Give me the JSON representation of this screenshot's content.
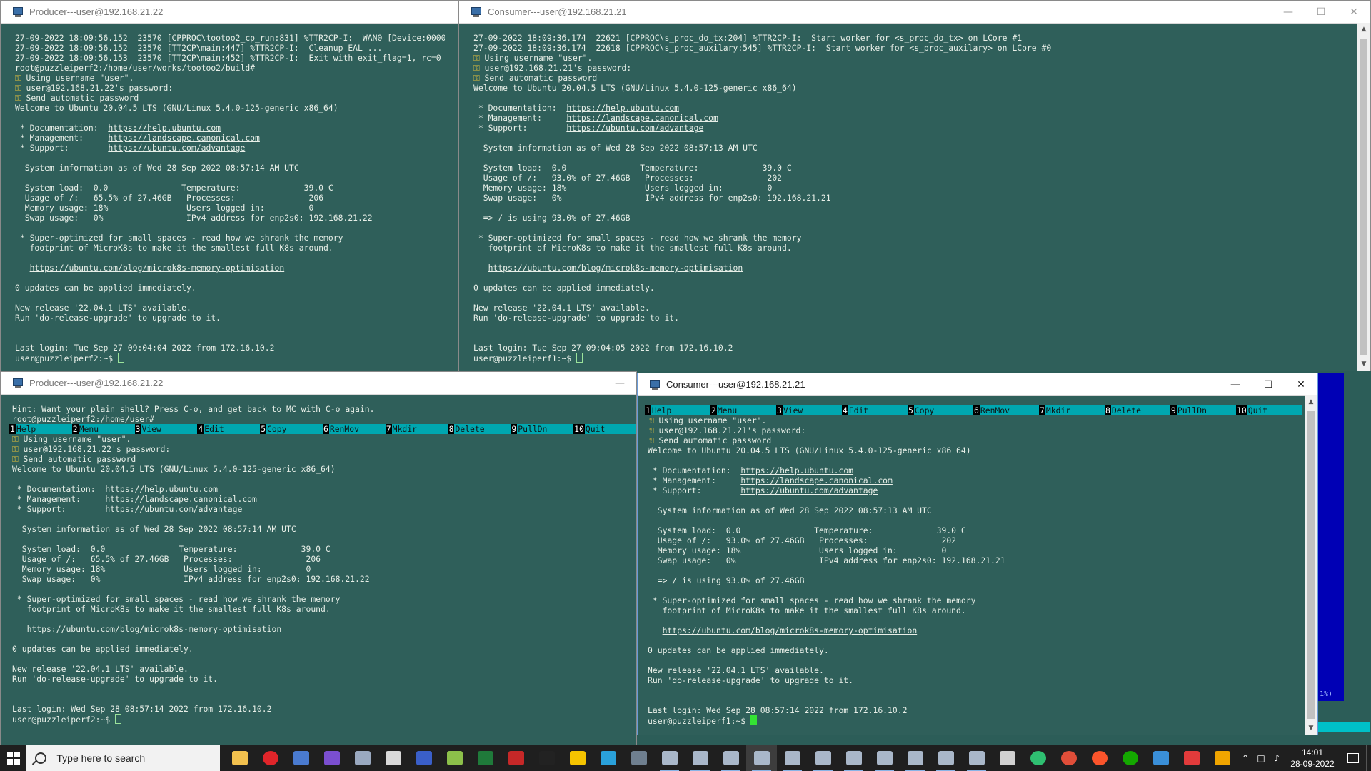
{
  "windows": {
    "w1": {
      "title": "Producer---user@192.168.21.22",
      "lines": [
        "27-09-2022 18:09:56.152  23570 [CPPROC\\tootoo2_cp_run:831] %TTR2CP-I:  WAN0 [Device:0000:",
        "27-09-2022 18:09:56.152  23570 [TT2CP\\main:447] %TTR2CP-I:  Cleanup EAL ...",
        "27-09-2022 18:09:56.153  23570 [TT2CP\\main:452] %TTR2CP-I:  Exit with exit_flag=1, rc=0",
        "root@puzzleiperf2:/home/user/works/tootoo2/build#",
        "Using username \"user\".",
        "user@192.168.21.22's password:",
        "Send automatic password",
        "Welcome to Ubuntu 20.04.5 LTS (GNU/Linux 5.4.0-125-generic x86_64)",
        "",
        " * Documentation:  https://help.ubuntu.com",
        " * Management:     https://landscape.canonical.com",
        " * Support:        https://ubuntu.com/advantage",
        "",
        "  System information as of Wed 28 Sep 2022 08:57:14 AM UTC",
        "",
        "  System load:  0.0               Temperature:             39.0 C",
        "  Usage of /:   65.5% of 27.46GB   Processes:               206",
        "  Memory usage: 18%                Users logged in:         0",
        "  Swap usage:   0%                 IPv4 address for enp2s0: 192.168.21.22",
        "",
        " * Super-optimized for small spaces - read how we shrank the memory",
        "   footprint of MicroK8s to make it the smallest full K8s around.",
        "",
        "   https://ubuntu.com/blog/microk8s-memory-optimisation",
        "",
        "0 updates can be applied immediately.",
        "",
        "New release '22.04.1 LTS' available.",
        "Run 'do-release-upgrade' to upgrade to it.",
        "",
        "",
        "Last login: Tue Sep 27 09:04:04 2022 from 172.16.10.2",
        "user@puzzleiperf2:~$ "
      ]
    },
    "w2": {
      "title": "Consumer---user@192.168.21.21",
      "lines": [
        "27-09-2022 18:09:36.174  22621 [CPPROC\\s_proc_do_tx:204] %TTR2CP-I:  Start worker for <s_proc_do_tx> on LCore #1",
        "27-09-2022 18:09:36.174  22618 [CPPROC\\s_proc_auxilary:545] %TTR2CP-I:  Start worker for <s_proc_auxilary> on LCore #0",
        "Using username \"user\".",
        "user@192.168.21.21's password:",
        "Send automatic password",
        "Welcome to Ubuntu 20.04.5 LTS (GNU/Linux 5.4.0-125-generic x86_64)",
        "",
        " * Documentation:  https://help.ubuntu.com",
        " * Management:     https://landscape.canonical.com",
        " * Support:        https://ubuntu.com/advantage",
        "",
        "  System information as of Wed 28 Sep 2022 08:57:13 AM UTC",
        "",
        "  System load:  0.0               Temperature:             39.0 C",
        "  Usage of /:   93.0% of 27.46GB   Processes:               202",
        "  Memory usage: 18%                Users logged in:         0",
        "  Swap usage:   0%                 IPv4 address for enp2s0: 192.168.21.21",
        "",
        "  => / is using 93.0% of 27.46GB",
        "",
        " * Super-optimized for small spaces - read how we shrank the memory",
        "   footprint of MicroK8s to make it the smallest full K8s around.",
        "",
        "   https://ubuntu.com/blog/microk8s-memory-optimisation",
        "",
        "0 updates can be applied immediately.",
        "",
        "New release '22.04.1 LTS' available.",
        "Run 'do-release-upgrade' to upgrade to it.",
        "",
        "",
        "Last login: Tue Sep 27 09:04:05 2022 from 172.16.10.2",
        "user@puzzleiperf1:~$ "
      ]
    },
    "w3": {
      "title": "Producer---user@192.168.21.22",
      "lines": [
        "Hint: Want your plain shell? Press C-o, and get back to MC with C-o again.",
        "root@puzzleiperf2:/home/user#",
        "@MCBAR",
        "Using username \"user\".",
        "user@192.168.21.22's password:",
        "Send automatic password",
        "Welcome to Ubuntu 20.04.5 LTS (GNU/Linux 5.4.0-125-generic x86_64)",
        "",
        " * Documentation:  https://help.ubuntu.com",
        " * Management:     https://landscape.canonical.com",
        " * Support:        https://ubuntu.com/advantage",
        "",
        "  System information as of Wed 28 Sep 2022 08:57:14 AM UTC",
        "",
        "  System load:  0.0               Temperature:             39.0 C",
        "  Usage of /:   65.5% of 27.46GB   Processes:               206",
        "  Memory usage: 18%                Users logged in:         0",
        "  Swap usage:   0%                 IPv4 address for enp2s0: 192.168.21.22",
        "",
        " * Super-optimized for small spaces - read how we shrank the memory",
        "   footprint of MicroK8s to make it the smallest full K8s around.",
        "",
        "   https://ubuntu.com/blog/microk8s-memory-optimisation",
        "",
        "0 updates can be applied immediately.",
        "",
        "New release '22.04.1 LTS' available.",
        "Run 'do-release-upgrade' to upgrade to it.",
        "",
        "",
        "Last login: Wed Sep 28 08:57:14 2022 from 172.16.10.2",
        "user@puzzleiperf2:~$ "
      ]
    },
    "w4": {
      "title": "Consumer---user@192.168.21.21",
      "lines": [
        "@MCBAR",
        "Using username \"user\".",
        "user@192.168.21.21's password:",
        "Send automatic password",
        "Welcome to Ubuntu 20.04.5 LTS (GNU/Linux 5.4.0-125-generic x86_64)",
        "",
        " * Documentation:  https://help.ubuntu.com",
        " * Management:     https://landscape.canonical.com",
        " * Support:        https://ubuntu.com/advantage",
        "",
        "  System information as of Wed 28 Sep 2022 08:57:13 AM UTC",
        "",
        "  System load:  0.0               Temperature:             39.0 C",
        "  Usage of /:   93.0% of 27.46GB   Processes:               202",
        "  Memory usage: 18%                Users logged in:         0",
        "  Swap usage:   0%                 IPv4 address for enp2s0: 192.168.21.21",
        "",
        "  => / is using 93.0% of 27.46GB",
        "",
        " * Super-optimized for small spaces - read how we shrank the memory",
        "   footprint of MicroK8s to make it the smallest full K8s around.",
        "",
        "   https://ubuntu.com/blog/microk8s-memory-optimisation",
        "",
        "0 updates can be applied immediately.",
        "",
        "New release '22.04.1 LTS' available.",
        "Run 'do-release-upgrade' to upgrade to it.",
        "",
        "",
        "Last login: Wed Sep 28 08:57:14 2022 from 172.16.10.2",
        "user@puzzleiperf1:~$ "
      ]
    }
  },
  "mc_bar": [
    {
      "num": "1",
      "label": "Help"
    },
    {
      "num": "2",
      "label": "Menu"
    },
    {
      "num": "3",
      "label": "View"
    },
    {
      "num": "4",
      "label": "Edit"
    },
    {
      "num": "5",
      "label": "Copy"
    },
    {
      "num": "6",
      "label": "RenMov"
    },
    {
      "num": "7",
      "label": "Mkdir"
    },
    {
      "num": "8",
      "label": "Delete"
    },
    {
      "num": "9",
      "label": "PullDn"
    },
    {
      "num": "10",
      "label": "Quit"
    }
  ],
  "bg_panel_text": "1%)",
  "taskbar": {
    "search_placeholder": "Type here to search",
    "time": "14:01",
    "date": "28-09-2022",
    "apps": [
      {
        "icon": "file-explorer-icon",
        "color": "#f2c14e"
      },
      {
        "icon": "opera-icon",
        "color": "#e0252a"
      },
      {
        "icon": "network-tool-icon",
        "color": "#4a7bd0"
      },
      {
        "icon": "visual-studio-icon",
        "color": "#7b4fd0"
      },
      {
        "icon": "remote-tool-icon",
        "color": "#9aa9c0"
      },
      {
        "icon": "clock-app-icon",
        "color": "#d9d9d9"
      },
      {
        "icon": "save-app-icon",
        "color": "#3a5fc9"
      },
      {
        "icon": "notepadpp-icon",
        "color": "#8cc04a"
      },
      {
        "icon": "excel-icon",
        "color": "#1f7a3a"
      },
      {
        "icon": "filezilla-icon",
        "color": "#c62828"
      },
      {
        "icon": "terminal-icon",
        "color": "#222222"
      },
      {
        "icon": "folder-app-icon",
        "color": "#f5c400"
      },
      {
        "icon": "telegram-icon",
        "color": "#2aa1da"
      },
      {
        "icon": "chat-app-icon",
        "color": "#6f7f8f"
      },
      {
        "icon": "putty-icon-1",
        "color": "#a9b7c9"
      },
      {
        "icon": "putty-icon-2",
        "color": "#a9b7c9"
      },
      {
        "icon": "putty-icon-3",
        "color": "#a9b7c9"
      },
      {
        "icon": "putty-icon-4",
        "color": "#a9b7c9"
      },
      {
        "icon": "putty-icon-5",
        "color": "#a9b7c9"
      },
      {
        "icon": "putty-icon-6",
        "color": "#a9b7c9"
      },
      {
        "icon": "putty-icon-7",
        "color": "#a9b7c9"
      },
      {
        "icon": "putty-icon-8",
        "color": "#a9b7c9"
      },
      {
        "icon": "putty-icon-9",
        "color": "#a9b7c9"
      },
      {
        "icon": "putty-icon-10",
        "color": "#a9b7c9"
      },
      {
        "icon": "putty-icon-11",
        "color": "#a9b7c9"
      },
      {
        "icon": "document-app-icon",
        "color": "#d0d0d0"
      },
      {
        "icon": "sync-app-icon",
        "color": "#2fbf71"
      },
      {
        "icon": "git-icon",
        "color": "#e04e39"
      },
      {
        "icon": "brave-icon",
        "color": "#fb542b"
      },
      {
        "icon": "upwork-icon",
        "color": "#14a800"
      },
      {
        "icon": "remote-desktop-icon",
        "color": "#3a8fd8"
      },
      {
        "icon": "screen-capture-icon",
        "color": "#e23b3b"
      },
      {
        "icon": "window-app-icon",
        "color": "#f0a500"
      }
    ]
  }
}
